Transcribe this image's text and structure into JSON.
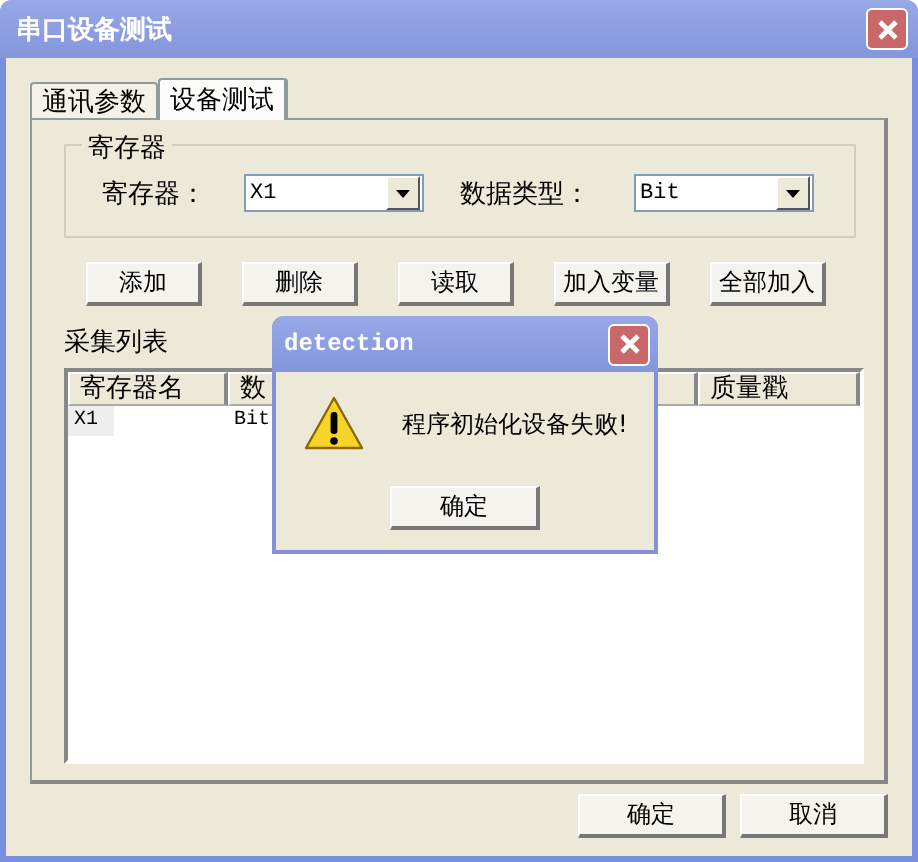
{
  "window": {
    "title": "串口设备测试"
  },
  "tabs": [
    {
      "label": "通讯参数",
      "selected": false
    },
    {
      "label": "设备测试",
      "selected": true
    }
  ],
  "register_group": {
    "title": "寄存器",
    "register_label": "寄存器：",
    "register_value": "X1",
    "type_label": "数据类型：",
    "type_value": "Bit"
  },
  "action_buttons": [
    "添加",
    "删除",
    "读取",
    "加入变量",
    "全部加入"
  ],
  "list": {
    "title": "采集列表",
    "columns": [
      "寄存器名",
      "数",
      "质量戳"
    ],
    "rows": [
      [
        "X1",
        "Bit"
      ]
    ]
  },
  "dialog": {
    "title": "detection",
    "message": "程序初始化设备失败!",
    "button": "确定"
  },
  "buttons": [
    "确定",
    "取消"
  ]
}
